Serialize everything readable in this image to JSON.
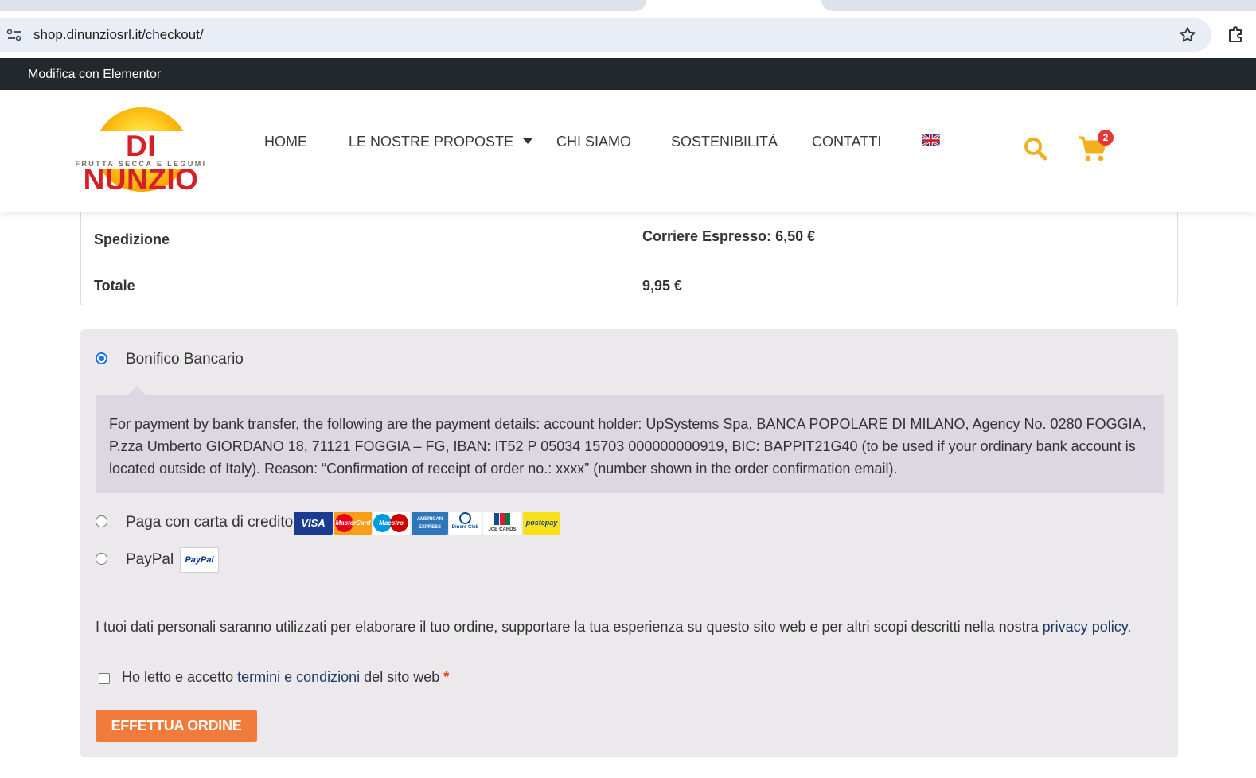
{
  "browser": {
    "url": "shop.dinunziosrl.it/checkout/"
  },
  "adminbar": {
    "edit_label": "Modifica con Elementor"
  },
  "header": {
    "logo_name": "DI NUNZIO",
    "logo_tagline": "FRUTTA SECCA E LEGUMI",
    "nav": [
      "HOME",
      "LE NOSTRE PROPOSTE",
      "CHI SIAMO",
      "SOSTENIBILITÀ",
      "CONTATTI"
    ],
    "language_icon": "uk-flag-icon",
    "cart_count": "2"
  },
  "totals": {
    "shipping_label": "Spedizione",
    "shipping_value": "Corriere Espresso: 6,50 €",
    "total_label": "Totale",
    "total_value": "9,95 €"
  },
  "payment": {
    "methods": [
      {
        "label": "Bonifico Bancario",
        "selected": true
      },
      {
        "label": "Paga con carta di credito",
        "selected": false
      },
      {
        "label": "PayPal",
        "selected": false
      }
    ],
    "bank_description": "For payment by bank transfer, the following are the payment details: account holder: UpSystems Spa, BANCA POPOLARE DI MILANO, Agency No. 0280 FOGGIA, P.zza Umberto GIORDANO 18, 71121 FOGGIA – FG, IBAN: IT52 P 05034 15703 000000000919, BIC: BAPPIT21G40 (to be used if your ordinary bank account is located outside of Italy). Reason: “Confirmation of receipt of order no.: xxxx” (number shown in the order confirmation email).",
    "cards": [
      "VISA",
      "MasterCard",
      "Maestro",
      "AMERICAN EXPRESS",
      "Diners Club",
      "JCB CARDS",
      "postepay"
    ],
    "paypal_logo": "PayPal"
  },
  "privacy": {
    "text": "I tuoi dati personali saranno utilizzati per elaborare il tuo ordine, supportare la tua esperienza su questo sito web e per altri scopi descritti nella nostra ",
    "link": "privacy policy",
    "suffix": "."
  },
  "terms": {
    "prefix": "Ho letto e accetto ",
    "link": "termini e condizioni",
    "suffix": " del sito web",
    "required": "*"
  },
  "order_button": "EFFETTUA ORDINE",
  "colors": {
    "accent_orange": "#f07b3b",
    "icon_yellow": "#f2b01e",
    "brand_red": "#d61f26",
    "admin_bar": "#23282d"
  }
}
